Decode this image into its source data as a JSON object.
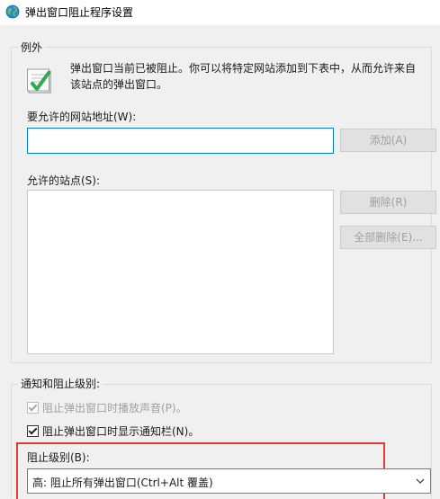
{
  "window": {
    "title": "弹出窗口阻止程序设置"
  },
  "exceptions": {
    "group_label": "例外",
    "description_line1": "弹出窗口当前已被阻止。你可以将特定网站添加到下表中，从而允许来自",
    "description_line2": "该站点的弹出窗口。",
    "address_label": "要允许的网站地址(W):",
    "address_value": "",
    "add_button": "添加(A)",
    "allowed_sites_label": "允许的站点(S):",
    "allowed_sites": [],
    "remove_button": "删除(R)",
    "remove_all_button": "全部删除(E)..."
  },
  "notifications": {
    "group_label": "通知和阻止级别:",
    "play_sound_label": "阻止弹出窗口时播放声音(P)。",
    "play_sound_checked": true,
    "play_sound_enabled": false,
    "show_bar_label": "阻止弹出窗口时显示通知栏(N)。",
    "show_bar_checked": true,
    "block_level_label": "阻止级别(B):",
    "block_level_value": "高: 阻止所有弹出窗口(Ctrl+Alt 覆盖)"
  },
  "icons": {
    "title": "globe-icon",
    "info": "checklist-icon",
    "dropdown": "chevron-down-icon"
  },
  "colors": {
    "focus_border": "#0078d7",
    "highlight": "#e03a3a",
    "dialog_bg": "#f0f0f0"
  }
}
